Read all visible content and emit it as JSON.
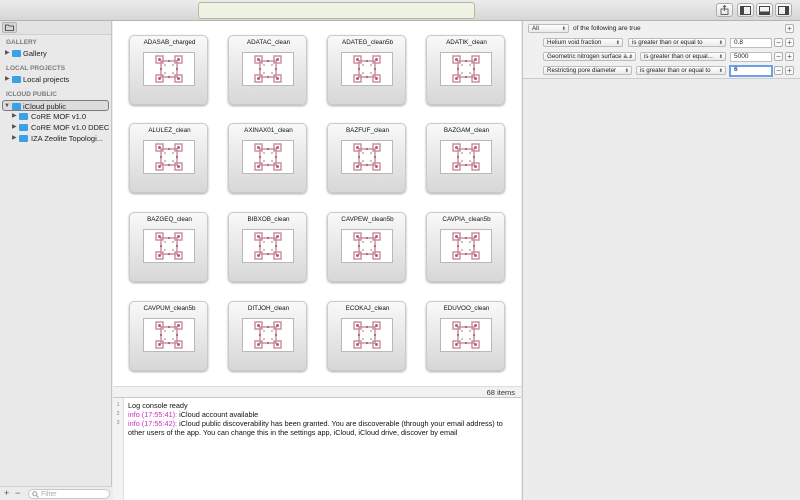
{
  "window": {
    "title_field": ""
  },
  "toolbar": {
    "buttons": [
      {
        "icon": "share-icon"
      },
      {
        "icon": "left-pane-icon"
      },
      {
        "icon": "bottom-pane-icon"
      },
      {
        "icon": "right-pane-icon"
      }
    ]
  },
  "sidebar": {
    "sections": [
      {
        "header": "GALLERY",
        "items": [
          {
            "label": "Gallery",
            "expanded": false
          }
        ]
      },
      {
        "header": "LOCAL PROJECTS",
        "items": [
          {
            "label": "Local projects",
            "expanded": false
          }
        ]
      },
      {
        "header": "ICLOUD PUBLIC",
        "items": [
          {
            "label": "iCloud public",
            "expanded": true,
            "selected": true
          },
          {
            "label": "CoRE MOF v1.0",
            "expanded": false,
            "child": true
          },
          {
            "label": "CoRE MOF v1.0 DDEC",
            "expanded": false,
            "child": true
          },
          {
            "label": "IZA Zeolite Topologi...",
            "expanded": false,
            "child": true
          }
        ]
      }
    ],
    "filter_placeholder": "Filter",
    "add_label": "+",
    "remove_label": "−"
  },
  "grid": {
    "items": [
      "ADASAB_charged",
      "ADATAC_clean",
      "ADATEG_clean5b",
      "ADATIK_clean",
      "ALULEZ_clean",
      "AXINAX01_clean",
      "BAZFUF_clean",
      "BAZGAM_clean",
      "BAZGEQ_clean",
      "BIBXOB_clean",
      "CAVPEW_clean5b",
      "CAVPIA_clean5b",
      "CAVPUM_clean5b",
      "DITJOH_clean",
      "ECOKAJ_clean",
      "EDUVOO_clean"
    ],
    "item_count": "68 items"
  },
  "console": {
    "line_numbers": [
      "1",
      "2",
      "3"
    ],
    "lines": [
      {
        "ts": "",
        "text": "Log console ready"
      },
      {
        "ts": "info (17:55:41):",
        "text": " iCloud account available"
      },
      {
        "ts": "info (17:55:42):",
        "text": " iCloud public discoverability has been granted. You are discoverable (through your email address) to other users of the app. You can change this in the settings app, iCloud, iCloud drive, discover by email"
      }
    ]
  },
  "predicate": {
    "match_mode": "All",
    "match_suffix": "of the following are true",
    "rules": [
      {
        "field": "Helium void fraction",
        "operator": "is greater than or equal to",
        "value": "0.8"
      },
      {
        "field": "Geometric nitrogen surface a...",
        "operator": "is greater than or equal...",
        "value": "5000"
      },
      {
        "field": "Restricting pore diameter",
        "operator": "is greater than or equal to",
        "value": "6"
      }
    ],
    "add_label": "+",
    "remove_label": "−"
  },
  "colors": {
    "folder": "#3ba0e6",
    "log_timestamp": "#c62fc4",
    "focus_ring": "#6da0e8"
  }
}
